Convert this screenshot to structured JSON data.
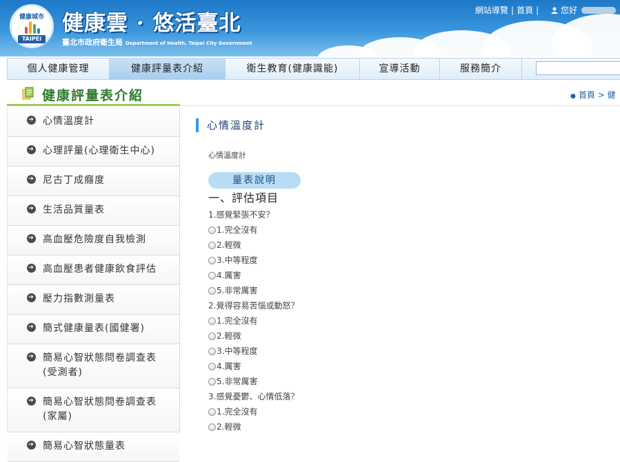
{
  "header": {
    "logo_top_text": "健康城市",
    "logo_badge": "TAIPEI",
    "title": "健康雲 · 悠活臺北",
    "subtitle": "臺北市政府衛生局",
    "subtitle_en": "Department of Health, Taipei City Government",
    "links": {
      "sitemap": "網站導覽",
      "home": "首頁",
      "greeting": "您好"
    }
  },
  "nav": {
    "items": [
      "個人健康管理",
      "健康評量表介紹",
      "衛生教育(健康識能)",
      "宣導活動",
      "服務簡介"
    ],
    "active_index": 1
  },
  "section": {
    "title": "健康評量表介紹",
    "breadcrumb_home": "首頁",
    "breadcrumb_sep": ">",
    "breadcrumb_current": "健"
  },
  "sidebar": {
    "items": [
      "心情溫度計",
      "心理評量(心理衛生中心)",
      "尼古丁成癮度",
      "生活品質量表",
      "高血壓危險度自我檢測",
      "高血壓患者健康飲食評估",
      "壓力指數測量表",
      "簡式健康量表(國健署)",
      "簡易心智狀態問卷調查表(受測者)",
      "簡易心智狀態問卷調查表(家屬)",
      "簡易心智狀態量表"
    ]
  },
  "main": {
    "heading": "心情溫度計",
    "subline": "心情溫度計",
    "pill": "量表說明",
    "section_head": "一、評估項目",
    "questions": [
      {
        "q": "1.感覺緊張不安？",
        "options": [
          "1.完全沒有",
          "2.輕微",
          "3.中等程度",
          "4.厲害",
          "5.非常厲害"
        ]
      },
      {
        "q": "2.覺得容易苦惱或動怒？",
        "options": [
          "1.完全沒有",
          "2.輕微",
          "3.中等程度",
          "4.厲害",
          "5.非常厲害"
        ]
      },
      {
        "q": "3.感覺憂鬱、心情低落？",
        "options": [
          "1.完全沒有",
          "2.輕微"
        ]
      }
    ]
  },
  "colors": {
    "header_blue": "#1d78c8",
    "accent_green": "#2e7b2e",
    "pill_blue": "#b8dcf5"
  }
}
